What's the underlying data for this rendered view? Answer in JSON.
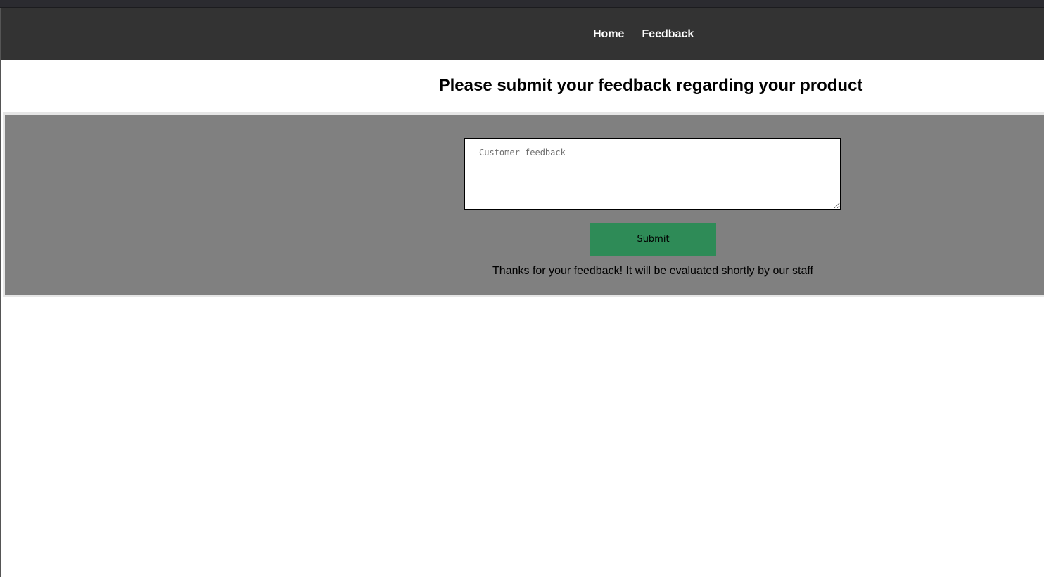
{
  "colors": {
    "navbar_bg": "#333333",
    "panel_bg": "#808080",
    "submit_bg": "#2e8b57",
    "nav_text": "#ffffff"
  },
  "nav": {
    "items": [
      {
        "label": "Home"
      },
      {
        "label": "Feedback"
      }
    ]
  },
  "main": {
    "title": "Please submit your feedback regarding your product",
    "feedback": {
      "value": "",
      "placeholder": "Customer feedback"
    },
    "submit_label": "Submit",
    "confirmation": "Thanks for your feedback! It will be evaluated shortly by our staff"
  }
}
